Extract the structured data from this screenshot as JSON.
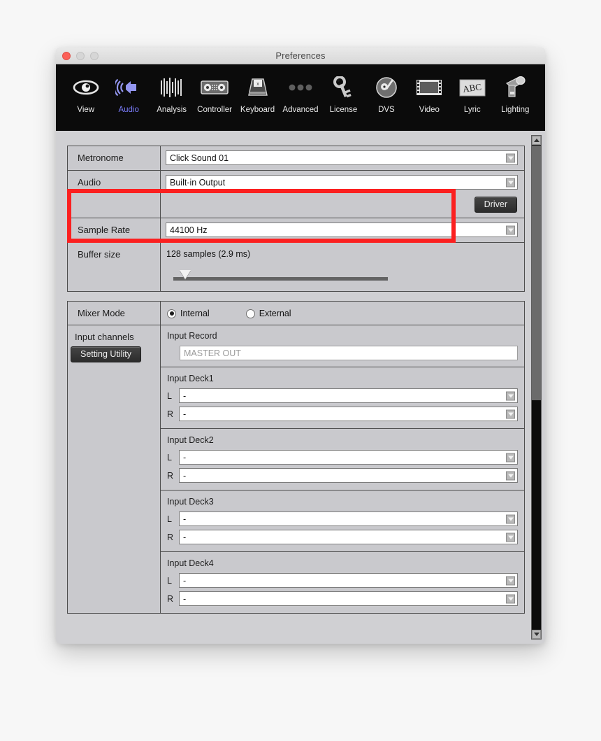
{
  "window": {
    "title": "Preferences",
    "traffic_lights": [
      "close",
      "minimize",
      "zoom"
    ]
  },
  "toolbar": {
    "items": [
      {
        "label": "View",
        "icon": "eye-icon",
        "active": false
      },
      {
        "label": "Audio",
        "icon": "speaker-icon",
        "active": true
      },
      {
        "label": "Analysis",
        "icon": "waveform-icon",
        "active": false
      },
      {
        "label": "Controller",
        "icon": "controller-icon",
        "active": false
      },
      {
        "label": "Keyboard",
        "icon": "keyboard-icon",
        "active": false
      },
      {
        "label": "Advanced",
        "icon": "ellipsis-icon",
        "active": false
      },
      {
        "label": "License",
        "icon": "key-icon",
        "active": false
      },
      {
        "label": "DVS",
        "icon": "turntable-icon",
        "active": false
      },
      {
        "label": "Video",
        "icon": "filmstrip-icon",
        "active": false
      },
      {
        "label": "Lyric",
        "icon": "abc-icon",
        "active": false
      },
      {
        "label": "Lighting",
        "icon": "spotlight-icon",
        "active": false
      }
    ],
    "active_accent": "#7b7dfb"
  },
  "settings": {
    "metronome": {
      "label": "Metronome",
      "value": "Click Sound 01"
    },
    "audio": {
      "label": "Audio",
      "value": "Built-in Output",
      "driver_button": "Driver",
      "highlighted": true,
      "highlight_color": "#fb2020"
    },
    "sample_rate": {
      "label": "Sample Rate",
      "value": "44100 Hz"
    },
    "buffer_size": {
      "label": "Buffer size",
      "value": "128 samples (2.9 ms)",
      "slider_percent": 3
    },
    "mixer_mode": {
      "label": "Mixer Mode",
      "options": [
        "Internal",
        "External"
      ],
      "selected": "Internal"
    },
    "input_channels": {
      "label": "Input channels",
      "setting_utility_button": "Setting Utility",
      "input_record": {
        "title": "Input Record",
        "value": "MASTER OUT"
      },
      "decks": [
        {
          "title": "Input Deck1",
          "l_key": "L",
          "l_value": "-",
          "r_key": "R",
          "r_value": "-"
        },
        {
          "title": "Input Deck2",
          "l_key": "L",
          "l_value": "-",
          "r_key": "R",
          "r_value": "-"
        },
        {
          "title": "Input Deck3",
          "l_key": "L",
          "l_value": "-",
          "r_key": "R",
          "r_value": "-"
        },
        {
          "title": "Input Deck4",
          "l_key": "L",
          "l_value": "-",
          "r_key": "R",
          "r_value": "-"
        }
      ]
    }
  },
  "scrollbar": {
    "up_arrow": "scroll-up-icon",
    "down_arrow": "scroll-down-icon",
    "thumb_position_percent": 0
  }
}
